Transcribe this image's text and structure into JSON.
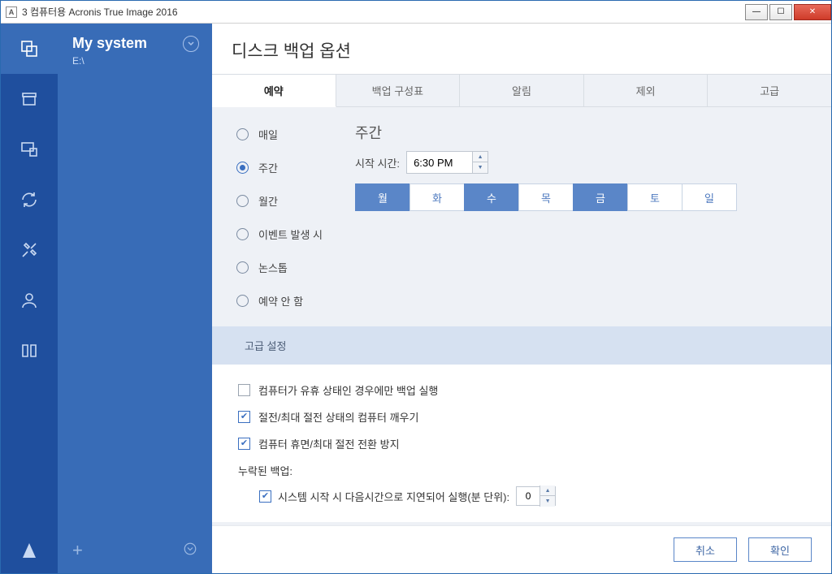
{
  "window": {
    "title": "3 컴퓨터용 Acronis True Image 2016"
  },
  "sidepanel": {
    "title": "My system",
    "subtitle": "E:\\"
  },
  "main": {
    "title": "디스크 백업 옵션"
  },
  "tabs": [
    "예약",
    "백업 구성표",
    "알림",
    "제외",
    "고급"
  ],
  "schedule": {
    "options": [
      "매일",
      "주간",
      "월간",
      "이벤트 발생 시",
      "논스톱",
      "예약 안 함"
    ],
    "selected": 1,
    "weekly_title": "주간",
    "start_label": "시작 시간:",
    "start_value": "6:30 PM",
    "days": [
      "월",
      "화",
      "수",
      "목",
      "금",
      "토",
      "일"
    ],
    "days_selected": [
      true,
      false,
      true,
      false,
      true,
      false,
      false
    ]
  },
  "advanced": {
    "header": "고급 설정",
    "chk1": {
      "checked": false,
      "label": "컴퓨터가 유휴 상태인 경우에만 백업 실행"
    },
    "chk2": {
      "checked": true,
      "label": "절전/최대 절전 상태의 컴퓨터 깨우기"
    },
    "chk3": {
      "checked": true,
      "label": "컴퓨터 휴면/최대 절전 전환 방지"
    },
    "missed_label": "누락된 백업:",
    "chk4": {
      "checked": true,
      "label": "시스템 시작 시 다음시간으로 지연되어 실행(분 단위):"
    },
    "delay_value": "0"
  },
  "footer": {
    "cancel": "취소",
    "ok": "확인"
  }
}
